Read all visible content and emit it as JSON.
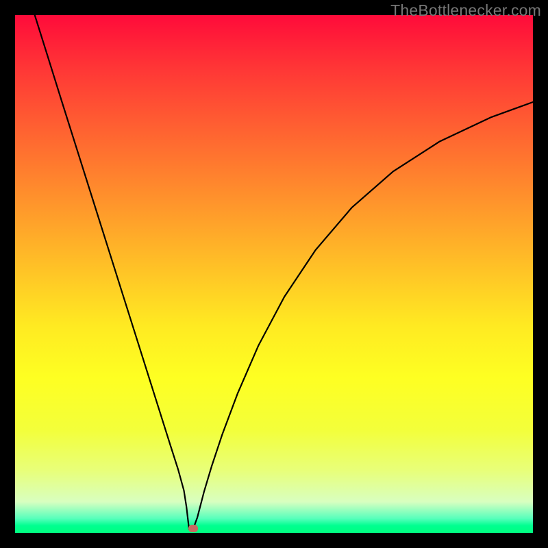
{
  "watermark": "TheBottlenecker.com",
  "colors": {
    "curve_stroke": "#000000",
    "marker_fill": "#c76a61"
  },
  "chart_data": {
    "type": "line",
    "title": "",
    "xlabel": "",
    "ylabel": "",
    "xlim": [
      0,
      100
    ],
    "ylim": [
      0,
      100
    ],
    "notch": {
      "x": 33.6,
      "y": 0
    },
    "marker": {
      "x": 34.4,
      "y": 0.8
    },
    "series": [
      {
        "name": "bottleneck-curve",
        "x": [
          3.8,
          6,
          9,
          12,
          15,
          18,
          21,
          24,
          27,
          30,
          31.5,
          32.6,
          33.1,
          33.6,
          34.1,
          34.4,
          35.2,
          36.5,
          38,
          40,
          43,
          47,
          52,
          58,
          65,
          73,
          82,
          92,
          100
        ],
        "y": [
          100,
          93,
          83.4,
          73.9,
          64.4,
          54.9,
          45.4,
          35.9,
          26.4,
          16.9,
          12.2,
          8.2,
          5.0,
          0.7,
          0.6,
          0.8,
          3.0,
          8.0,
          13.0,
          19.0,
          27.0,
          36.2,
          45.6,
          54.6,
          62.8,
          69.8,
          75.6,
          80.3,
          83.2
        ]
      }
    ]
  }
}
